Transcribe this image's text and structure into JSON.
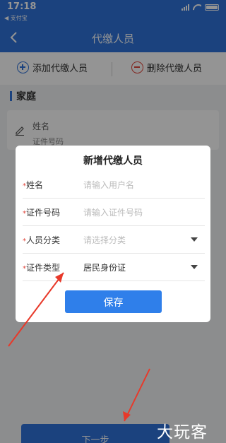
{
  "status": {
    "time": "17:18",
    "app": "◀ 支付宝"
  },
  "nav": {
    "title": "代缴人员"
  },
  "actions": {
    "add": "添加代缴人员",
    "remove": "删除代缴人员"
  },
  "section": {
    "title": "家庭"
  },
  "card": {
    "name_label": "姓名",
    "id_label": "证件号码"
  },
  "modal": {
    "title": "新增代缴人员",
    "fields": [
      {
        "label": "姓名",
        "required_mark": "*",
        "value": "",
        "placeholder": "请输入用户名"
      },
      {
        "label": "证件号码",
        "required_mark": "*",
        "value": "",
        "placeholder": "请输入证件号码"
      },
      {
        "label": "人员分类",
        "required_mark": "*",
        "value": "",
        "placeholder": "请选择分类"
      },
      {
        "label": "证件类型",
        "required_mark": "*",
        "value": "居民身份证",
        "placeholder": ""
      }
    ],
    "save_label": "保存"
  },
  "bottom": {
    "next_label": "下一步"
  },
  "watermark": {
    "text": "大玩客"
  },
  "colors": {
    "primary": "#2f73d9",
    "danger": "#e0453a",
    "annotation": "#e8392a"
  }
}
